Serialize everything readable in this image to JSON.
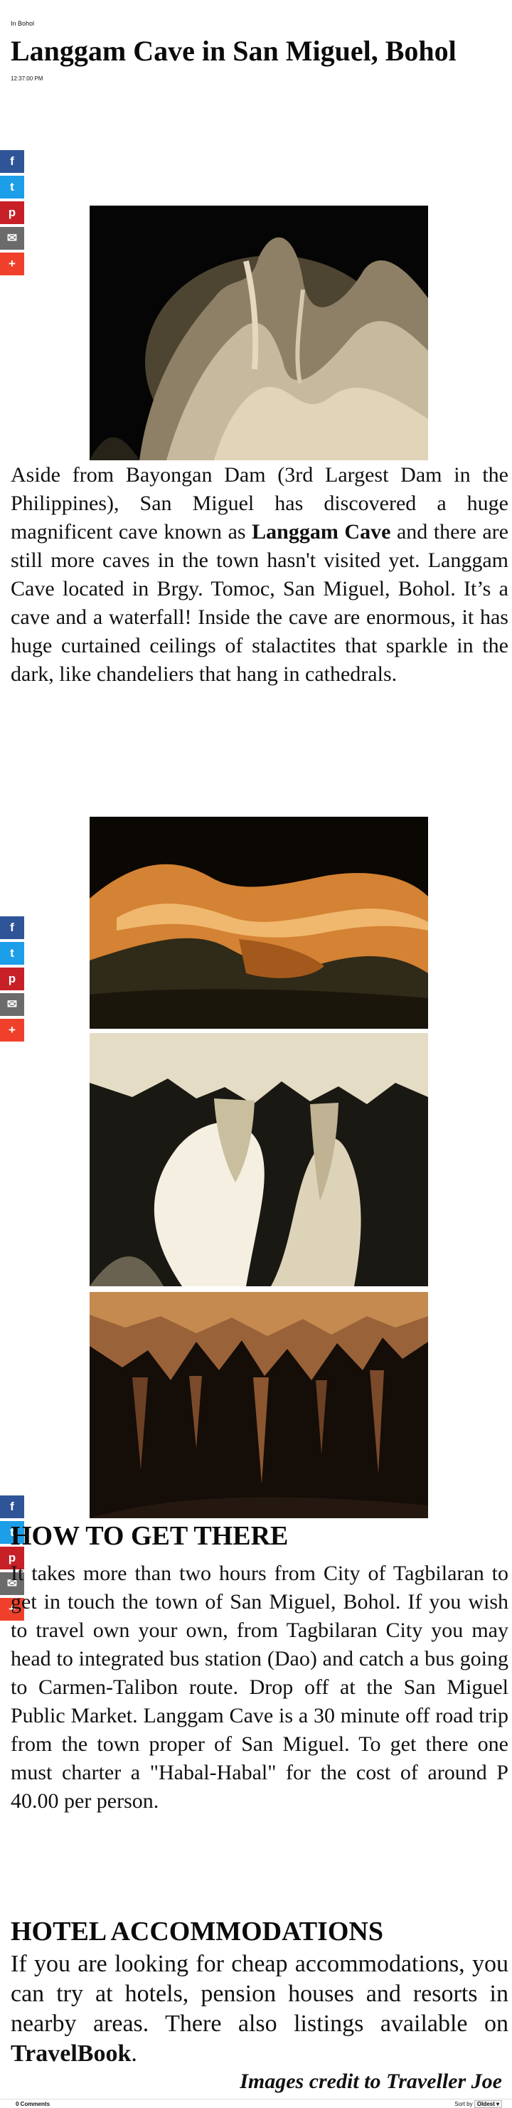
{
  "page": {
    "category": "In Bohol",
    "title": "Langgam Cave in San Miguel, Bohol",
    "time": "12:37:00 PM"
  },
  "share": {
    "facebook": "f",
    "twitter": "t",
    "pinterest": "p",
    "email": "✉",
    "more": "+"
  },
  "article": {
    "intro_before": "Aside from Bayongan Dam (3rd Largest Dam in the Philippines), San Miguel has discovered a huge magnificent cave known as ",
    "intro_bold": "Langgam Cave",
    "intro_after": " and there are still more caves in the town hasn't visited yet. Langgam Cave located in Brgy. Tomoc, San Miguel, Bohol. It’s a cave and a waterfall! Inside the cave are enormous, it has huge curtained ceilings of stalactites that sparkle in the dark, like chandeliers that hang in cathedrals.",
    "how_heading": "HOW TO GET THERE",
    "how_text": "It takes more than two hours from City of Tagbilaran to get in touch the town of San Miguel, Bohol. If you wish to travel own your own, from Tagbilaran City you may head to integrated bus station (Dao) and catch a bus going to Carmen-Talibon route. Drop off at the San Miguel Public Market. Langgam Cave is a 30 minute off road trip from the town proper of San Miguel. To get there one must charter a \"Habal-Habal\" for the cost of around P 40.00 per person.",
    "hotel_heading": "HOTEL ACCOMMODATIONS",
    "hotel_before": "  If you are looking for cheap accommodations, you can try at hotels, pension houses and resorts in nearby areas. There also listings available on ",
    "hotel_bold": "TravelBook",
    "hotel_after": ".",
    "credit": "Images credit to  Traveller Joe"
  },
  "comments": {
    "count": "0 Comments",
    "sort_label": "Sort by",
    "sort_value": "Oldest ▾"
  }
}
